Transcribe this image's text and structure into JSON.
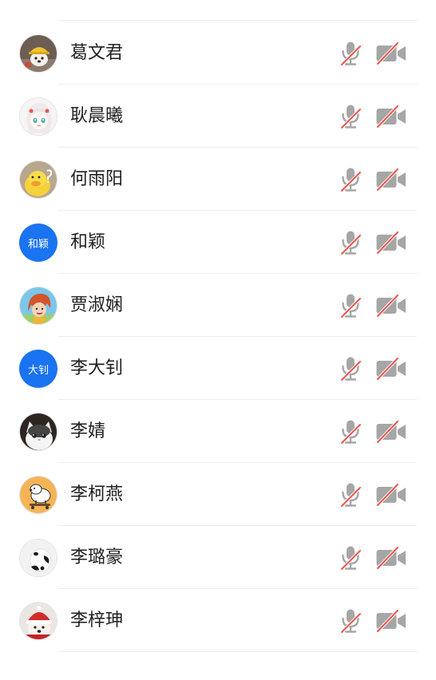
{
  "participants": [
    {
      "name": "葛文君",
      "avatar": {
        "kind": "image",
        "icon": "dog-with-hat-avatar-icon"
      },
      "mic": "muted",
      "camera": "off"
    },
    {
      "name": "耿晨曦",
      "avatar": {
        "kind": "image",
        "icon": "anime-girl-avatar-icon"
      },
      "mic": "muted",
      "camera": "off"
    },
    {
      "name": "何雨阳",
      "avatar": {
        "kind": "image",
        "icon": "yellow-duck-avatar-icon"
      },
      "mic": "muted",
      "camera": "off"
    },
    {
      "name": "和颖",
      "avatar": {
        "kind": "text",
        "text": "和颖",
        "color": "#1a73f0"
      },
      "mic": "muted",
      "camera": "off"
    },
    {
      "name": "贾淑娴",
      "avatar": {
        "kind": "image",
        "icon": "cartoon-girl-avatar-icon"
      },
      "mic": "muted",
      "camera": "off"
    },
    {
      "name": "李大钊",
      "avatar": {
        "kind": "text",
        "text": "大钊",
        "color": "#1a73f0"
      },
      "mic": "muted",
      "camera": "off"
    },
    {
      "name": "李婧",
      "avatar": {
        "kind": "image",
        "icon": "cat-avatar-icon"
      },
      "mic": "muted",
      "camera": "off"
    },
    {
      "name": "李柯燕",
      "avatar": {
        "kind": "image",
        "icon": "cartoon-dog-skateboard-avatar-icon"
      },
      "mic": "muted",
      "camera": "off"
    },
    {
      "name": "李璐豪",
      "avatar": {
        "kind": "image",
        "icon": "panda-avatar-icon"
      },
      "mic": "muted",
      "camera": "off"
    },
    {
      "name": "李梓珅",
      "avatar": {
        "kind": "image",
        "icon": "dog-santa-hat-avatar-icon"
      },
      "mic": "muted",
      "camera": "off"
    }
  ],
  "colors": {
    "accent": "#1a73f0",
    "icon_gray": "#a6a6a6",
    "mute_slash": "#e8574f",
    "text": "#1f1f1f",
    "divider": "#ededed"
  }
}
